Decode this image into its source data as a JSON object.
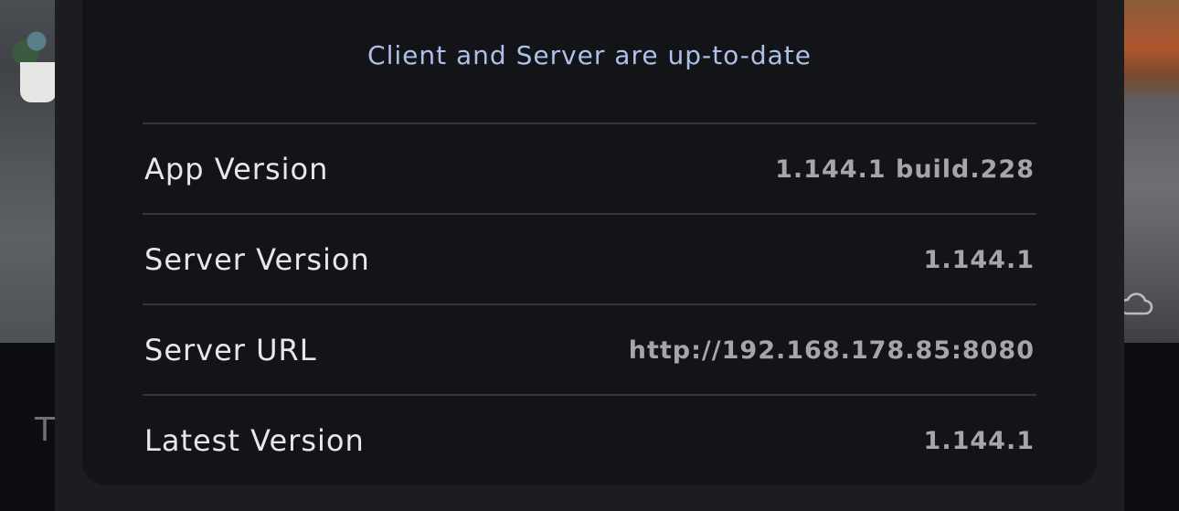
{
  "status_message": "Client and Server are up-to-date",
  "background": {
    "partial_text": "T"
  },
  "rows": [
    {
      "label": "App Version",
      "value": "1.144.1 build.228"
    },
    {
      "label": "Server Version",
      "value": "1.144.1"
    },
    {
      "label": "Server URL",
      "value": "http://192.168.178.85:8080"
    },
    {
      "label": "Latest Version",
      "value": "1.144.1"
    }
  ],
  "icons": {
    "cloud": "cloud-icon"
  },
  "colors": {
    "status_text": "#aebfe9",
    "label_text": "#e7e7ea",
    "value_text": "#a5a6aa",
    "card_bg": "#131418",
    "sheet_bg": "#1c1d21"
  }
}
